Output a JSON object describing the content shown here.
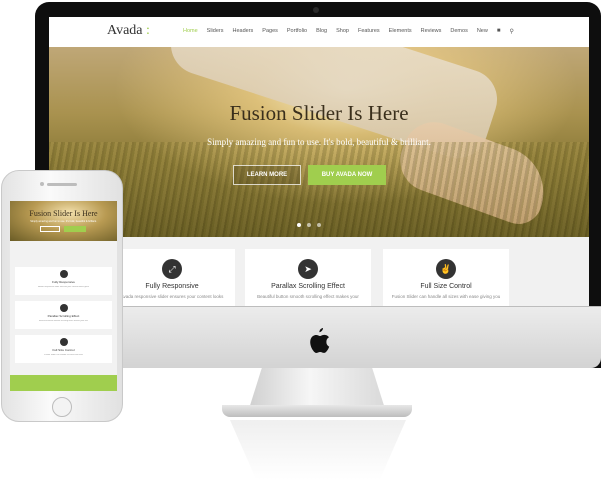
{
  "site": {
    "logo": "Avada",
    "logo_mark": ":",
    "nav": [
      "Home",
      "Sliders",
      "Headers",
      "Pages",
      "Portfolio",
      "Blog",
      "Shop",
      "Features",
      "Elements",
      "Reviews",
      "Demos",
      "New"
    ],
    "nav_icons": [
      "cart-icon",
      "search-icon"
    ]
  },
  "hero": {
    "title": "Fusion Slider Is Here",
    "subtitle": "Simply amazing and fun to use. It's bold, beautiful & brilliant.",
    "learn_more": "LEARN MORE",
    "buy": "BUY AVADA NOW",
    "slide_count": 3,
    "active_slide": 1
  },
  "features": [
    {
      "icon": "expand-icon",
      "title": "Fully Responsive",
      "text": "Avada responsive slider ensures your content looks"
    },
    {
      "icon": "rocket-icon",
      "title": "Parallax Scrolling Effect",
      "text": "Beautiful button smooth scrolling effect makes your"
    },
    {
      "icon": "thumbs-up-icon",
      "title": "Full Size Control",
      "text": "Fusion Slider can handle all sizes with ease giving you"
    }
  ],
  "phone": {
    "hero_title": "Fusion Slider Is Here",
    "hero_sub": "Simply amazing and fun to use. It's bold, beautiful & brilliant.",
    "cards": [
      {
        "title": "Fully Responsive",
        "text": "Avada responsive slider ensures your content looks great"
      },
      {
        "title": "Parallax Scrolling Effect",
        "text": "Beautiful button smooth scrolling effect makes your site"
      },
      {
        "title": "Full Size Control",
        "text": "Fusion Slider can handle all sizes with ease"
      }
    ]
  },
  "colors": {
    "accent": "#a0ce4e",
    "imac_bezel": "#0e0e0e",
    "text_dark": "#333333"
  }
}
